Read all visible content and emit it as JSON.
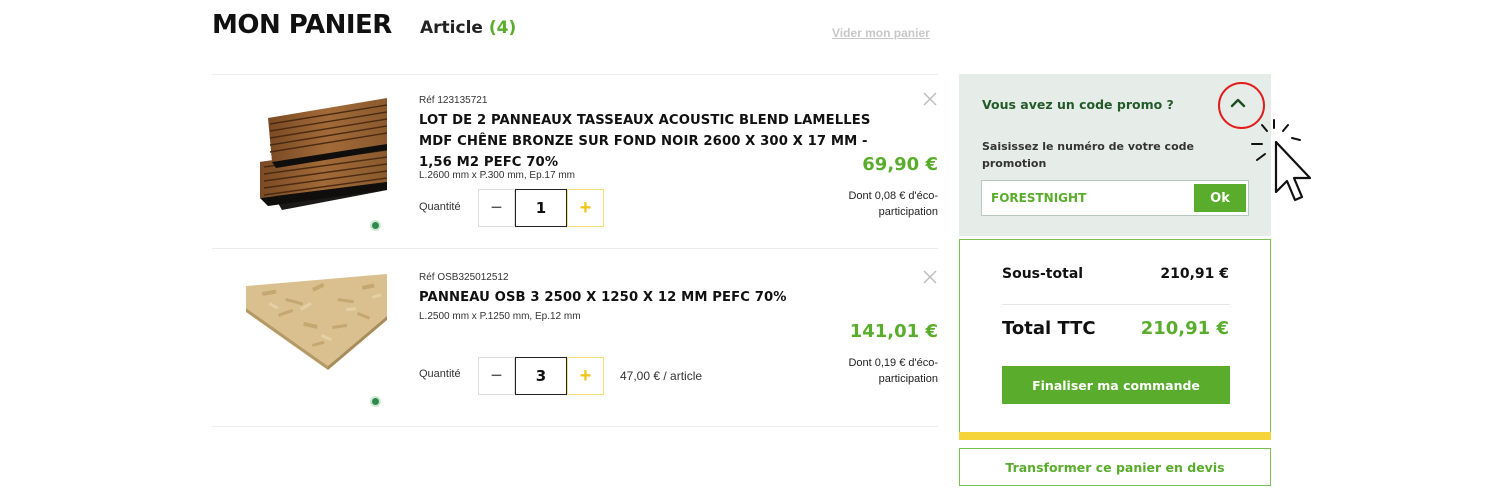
{
  "header": {
    "title": "MON PANIER",
    "article_label": "Article",
    "article_count": "(4)",
    "clear_cart": "Vider mon panier"
  },
  "cart": {
    "items": [
      {
        "ref": "Réf 123135721",
        "name": "LOT DE 2 PANNEAUX TASSEAUX ACOUSTIC BLEND LAMELLES MDF CHÊNE BRONZE SUR FOND NOIR 2600 X 300 X 17 MM - 1,56 M2 PEFC 70%",
        "dimensions": "L.2600 mm x P.300 mm, Ep.17 mm",
        "qty_label": "Quantité",
        "quantity": "1",
        "unit_price": "",
        "price": "69,90 €",
        "eco_participation": "Dont 0,08 € d'éco-participation",
        "image_icon": "wood-slat-panels-image",
        "badge_icon": "eco-leaf-icon"
      },
      {
        "ref": "Réf OSB325012512",
        "name": "PANNEAU OSB 3 2500 X 1250 X 12 MM PEFC 70%",
        "dimensions": "L.2500 mm x P.1250 mm, Ep.12 mm",
        "qty_label": "Quantité",
        "quantity": "3",
        "unit_price": "47,00 € / article",
        "price": "141,01 €",
        "eco_participation": "Dont 0,19 € d'éco-participation",
        "image_icon": "osb-board-image",
        "badge_icon": "eco-leaf-icon"
      }
    ],
    "remove_icon": "close-icon",
    "minus_symbol": "−",
    "plus_symbol": "+"
  },
  "promo": {
    "title": "Vous avez un code promo ?",
    "toggle_icon": "chevron-up-icon",
    "hint": "Saisissez le numéro de votre code promotion",
    "code_value": "FORESTNIGHT",
    "ok_label": "Ok"
  },
  "summary": {
    "subtotal_label": "Sous-total",
    "subtotal_value": "210,91 €",
    "total_label": "Total TTC",
    "total_value": "210,91 €",
    "checkout_label": "Finaliser ma commande",
    "quote_label": "Transformer ce panier en devis"
  },
  "colors": {
    "brand_green": "#5aad2c",
    "dark_green": "#245a2a",
    "accent_yellow": "#f5d33b",
    "highlight_red": "#e11d1d"
  }
}
